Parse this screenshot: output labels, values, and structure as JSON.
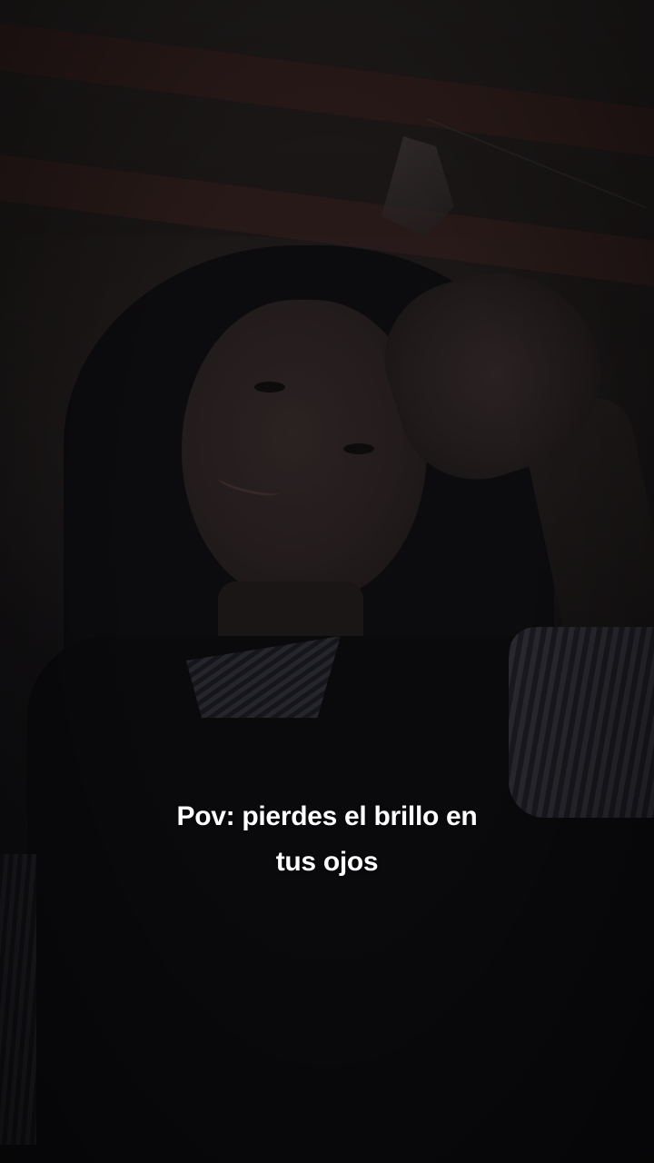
{
  "caption": {
    "line1": "Pov: pierdes el brillo en",
    "line2": "tus ojos"
  },
  "colors": {
    "caption_text": "#ffffff",
    "background": "#0b0a0c",
    "wall_stripe": "#2a1a19"
  }
}
